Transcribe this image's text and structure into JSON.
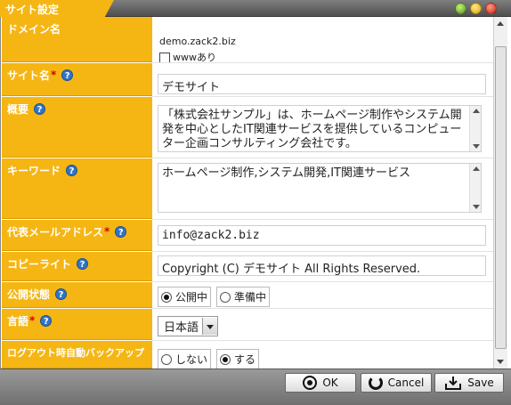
{
  "window": {
    "title": "サイト設定",
    "colors": {
      "accent": "#f5b614",
      "required": "#d40000",
      "help": "#2f74c8"
    }
  },
  "form": {
    "domain": {
      "label": "ドメイン名",
      "value": "demo.zack2.biz",
      "checkbox_label": "wwwあり",
      "checked": false
    },
    "site_name": {
      "label": "サイト名",
      "required_mark": "*",
      "value": "デモサイト"
    },
    "summary": {
      "label": "概要",
      "value": "「株式会社サンプル」は、ホームページ制作やシステム開発を中心としたIT関連サービスを提供しているコンピューター企画コンサルティング会社です。"
    },
    "keywords": {
      "label": "キーワード",
      "value": "ホームページ制作,システム開発,IT関連サービス"
    },
    "email": {
      "label": "代表メールアドレス",
      "required_mark": "*",
      "value": "info@zack2.biz"
    },
    "copyright": {
      "label": "コピーライト",
      "value": "Copyright (C) デモサイト All Rights Reserved."
    },
    "publish_status": {
      "label": "公開状態",
      "options": [
        "公開中",
        "準備中"
      ],
      "selected": "公開中"
    },
    "language": {
      "label": "言語",
      "required_mark": "*",
      "value": "日本語"
    },
    "auto_backup": {
      "label": "ログアウト時自動バックアップ",
      "options": [
        "しない",
        "する"
      ],
      "selected": "する"
    }
  },
  "buttons": {
    "ok": "OK",
    "cancel": "Cancel",
    "save": "Save"
  },
  "icons": {
    "help": "?"
  }
}
